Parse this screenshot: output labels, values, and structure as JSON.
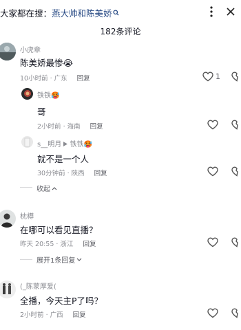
{
  "topbar": {
    "search_prefix": "大家都在搜：",
    "search_keyword": "燕大帅和陈美娇",
    "search_icon_glyph": "Q"
  },
  "comments_title": "182条评论",
  "comments": [
    {
      "user": "小虎章",
      "text": "陈美娇最惨😭",
      "time": "10小时前",
      "location": "广东",
      "reply_label": "回复",
      "like_count": "1",
      "replies": [
        {
          "user": "铁铁🥵",
          "text": "哥",
          "time": "2小时前",
          "location": "海南",
          "reply_label": "回复"
        },
        {
          "user_from": "s__明月",
          "user_to": "铁铁🥵",
          "text": "就不是一个人",
          "time": "30分钟前",
          "location": "陕西",
          "reply_label": "回复"
        }
      ],
      "fold_label": "收起"
    },
    {
      "user": "枕樽",
      "text": "在哪可以看见直播？",
      "time": "昨天 20:55",
      "location": "浙江",
      "reply_label": "回复",
      "expand_label": "展开1条回复"
    },
    {
      "user": "(_陈蒙厚爱(",
      "text": "全播，今天主P了吗？",
      "time": "2小时前",
      "location": "广西",
      "reply_label": "回复"
    }
  ],
  "icons": {
    "like": "heart-outline-icon",
    "dislike": "broken-heart-icon",
    "more": "more-vert-icon",
    "close": "close-icon"
  }
}
